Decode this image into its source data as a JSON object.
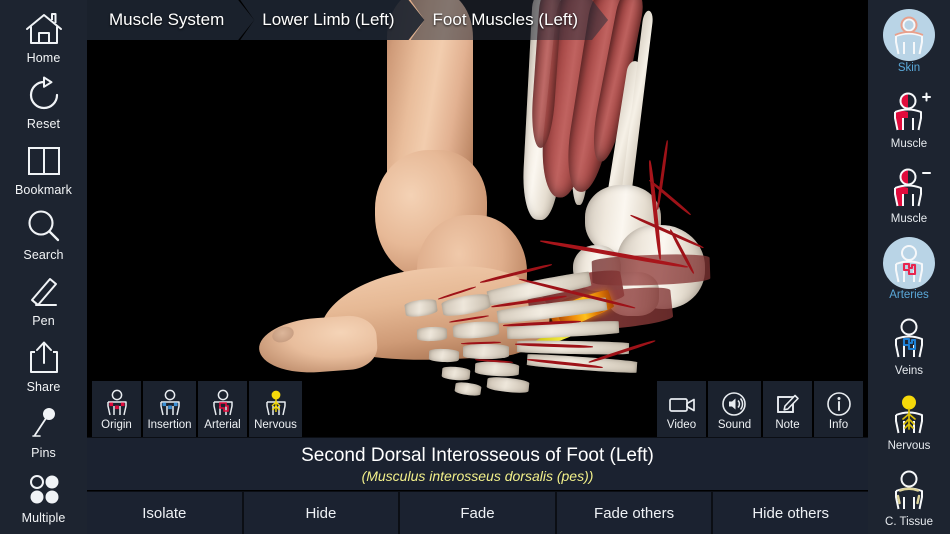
{
  "app": {
    "accent_blue": "#5aa8d8",
    "disc_blue": "#b9d4e6",
    "muscle_red": "#e10b3c",
    "panel_bg": "#1b2230",
    "rail_bg": "#1d2430",
    "latin_yellow": "#f2f08a",
    "highlight_orange": "#ffc21c"
  },
  "breadcrumb": [
    {
      "label": "Muscle System",
      "style": "solid"
    },
    {
      "label": "Lower Limb (Left)",
      "style": "solid"
    },
    {
      "label": "Foot Muscles (Left)",
      "style": "translucent"
    }
  ],
  "left_rail": {
    "items": [
      {
        "label": "Home",
        "icon": "home-icon"
      },
      {
        "label": "Reset",
        "icon": "reset-icon"
      },
      {
        "label": "Bookmark",
        "icon": "bookmark-icon"
      },
      {
        "label": "Search",
        "icon": "search-icon"
      },
      {
        "label": "Pen",
        "icon": "pen-icon"
      },
      {
        "label": "Share",
        "icon": "share-icon"
      },
      {
        "label": "Pins",
        "icon": "pin-icon"
      },
      {
        "label": "Multiple",
        "icon": "multiple-icon"
      }
    ]
  },
  "right_rail": {
    "items": [
      {
        "label": "Skin",
        "icon": "skin-layer-icon",
        "active": true
      },
      {
        "label": "Muscle",
        "icon": "muscle-add-icon",
        "active": false
      },
      {
        "label": "Muscle",
        "icon": "muscle-remove-icon",
        "active": false
      },
      {
        "label": "Arteries",
        "icon": "arteries-layer-icon",
        "active": true
      },
      {
        "label": "Veins",
        "icon": "veins-layer-icon",
        "active": false
      },
      {
        "label": "Nervous",
        "icon": "nervous-layer-icon",
        "active": false
      },
      {
        "label": "C. Tissue",
        "icon": "connective-tissue-icon",
        "active": false
      }
    ]
  },
  "toolbar": {
    "left_group": [
      {
        "label": "Origin",
        "icon": "origin-icon"
      },
      {
        "label": "Insertion",
        "icon": "insertion-icon"
      },
      {
        "label": "Arterial",
        "icon": "arterial-icon"
      },
      {
        "label": "Nervous",
        "icon": "nervous-icon"
      }
    ],
    "right_group": [
      {
        "label": "Video",
        "icon": "video-camera-icon"
      },
      {
        "label": "Sound",
        "icon": "speaker-icon"
      },
      {
        "label": "Note",
        "icon": "note-pencil-icon"
      },
      {
        "label": "Info",
        "icon": "info-circle-icon"
      }
    ]
  },
  "info": {
    "title": "Second Dorsal Interosseous of Foot (Left)",
    "latin": "(Musculus interosseus dorsalis (pes))"
  },
  "actions": [
    {
      "label": "Isolate"
    },
    {
      "label": "Hide"
    },
    {
      "label": "Fade"
    },
    {
      "label": "Fade others"
    },
    {
      "label": "Hide others"
    }
  ]
}
